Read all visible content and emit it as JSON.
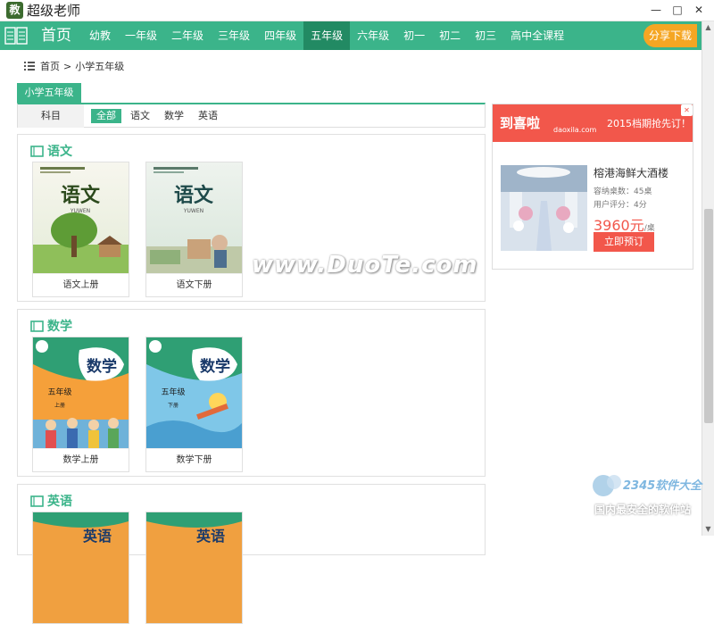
{
  "app": {
    "logo_char": "教",
    "title": "超级老师"
  },
  "window_controls": {
    "minimize": "—",
    "maximize": "□",
    "close": "✕"
  },
  "nav": {
    "home": "首页",
    "items": [
      "幼教",
      "一年级",
      "二年级",
      "三年级",
      "四年级",
      "五年级",
      "六年级",
      "初一",
      "初二",
      "初三",
      "高中全课程"
    ],
    "active_index": 5,
    "share": "分享下载"
  },
  "breadcrumb": {
    "home": "首页",
    "sep": ">",
    "current": "小学五年级"
  },
  "grade_tab": "小学五年级",
  "subject_filter": {
    "label": "科目",
    "items": [
      "全部",
      "语文",
      "数学",
      "英语"
    ],
    "active_index": 0
  },
  "sections": [
    {
      "title": "语文",
      "books": [
        {
          "label": "语文上册",
          "cover_title": "语文",
          "cover_sub": "YUWEN"
        },
        {
          "label": "语文下册",
          "cover_title": "语文",
          "cover_sub": "YUWEN"
        }
      ]
    },
    {
      "title": "数学",
      "books": [
        {
          "label": "数学上册",
          "cover_title": "数学",
          "grade": "五年级",
          "term": "上册"
        },
        {
          "label": "数学下册",
          "cover_title": "数学",
          "grade": "五年级",
          "term": "下册"
        }
      ]
    },
    {
      "title": "英语",
      "books": [
        {
          "label": "",
          "cover_title": "英语"
        },
        {
          "label": "",
          "cover_title": "英语"
        }
      ]
    }
  ],
  "ad": {
    "brand": "到喜啦",
    "site": "daoxila.com",
    "slogan": "2015档期抢先订！",
    "hotel": "榕港海鲜大酒楼",
    "capacity": "容纳桌数：45桌",
    "rating": "用户评分：4分",
    "price": "3960元",
    "price_unit": "/桌",
    "book_button": "立即预订"
  },
  "watermark": {
    "text": "www.DuoTe.com",
    "logo_text": "2345软件大全",
    "caption": "国内最安全的软件站"
  },
  "colors": {
    "brand_green": "#3bb48a",
    "nav_active": "#228a63",
    "share_orange": "#f5a623",
    "ad_red": "#f2574b"
  }
}
